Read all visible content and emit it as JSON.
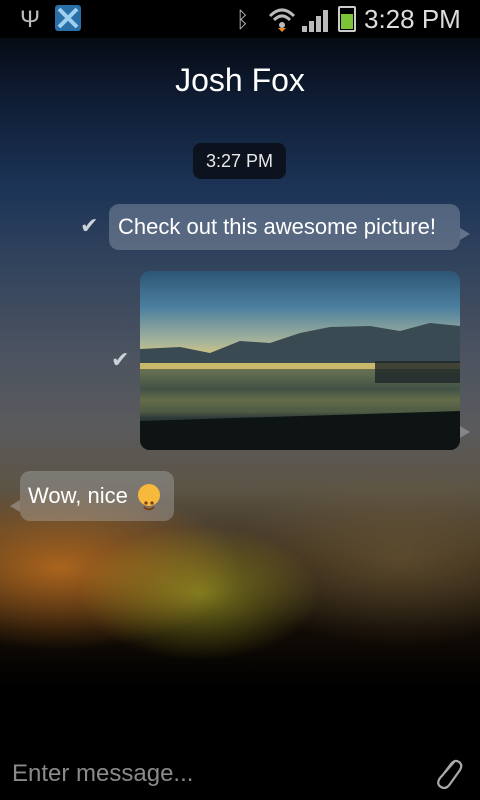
{
  "status_bar": {
    "time": "3:28 PM",
    "icons": [
      "usb-icon",
      "app-notification-icon",
      "bluetooth-icon",
      "wifi-icon",
      "signal-icon",
      "battery-charging-icon"
    ]
  },
  "chat": {
    "contact_name": "Josh Fox",
    "timestamp": "3:27 PM",
    "messages": [
      {
        "direction": "outgoing",
        "type": "text",
        "text": "Check out this awesome picture!",
        "delivered": true
      },
      {
        "direction": "outgoing",
        "type": "image",
        "description": "lake-landscape-photo",
        "delivered": true
      },
      {
        "direction": "incoming",
        "type": "text",
        "text": "Wow, nice",
        "emoji": "smiling-face-icon"
      }
    ]
  },
  "composer": {
    "placeholder": "Enter message...",
    "attach_icon": "paperclip-icon"
  },
  "colors": {
    "bubble": "#9aa0aa",
    "status_bar": "#000000",
    "timestamp_bg": "#0a0e16"
  }
}
